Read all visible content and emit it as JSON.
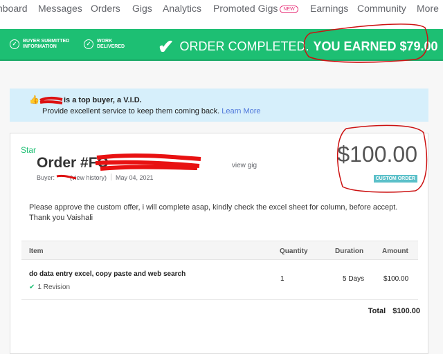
{
  "nav": {
    "items": [
      "hboard",
      "Messages",
      "Orders",
      "Gigs",
      "Analytics",
      "Promoted Gigs",
      "Earnings",
      "Community",
      "More"
    ],
    "new_badge": "NEW"
  },
  "banner": {
    "step1": [
      "BUYER SUBMITTED",
      "INFORMATION"
    ],
    "step2": [
      "WORK",
      "DELIVERED"
    ],
    "status": "ORDER COMPLETED.",
    "earned": "YOU EARNED $79.00"
  },
  "vid": {
    "line1": "is a top buyer, a V.I.D.",
    "line2": "Provide excellent service to keep them coming back.",
    "link": "Learn More"
  },
  "order": {
    "label": "Star",
    "title": "Order #FO",
    "view_gig": "view gig",
    "buyer_label": "Buyer:",
    "view_history": "(view history)",
    "date": "May 04, 2021",
    "price": "$100.00",
    "badge": "CUSTOM ORDER",
    "description": "Please approve the custom offer, i will complete asap, kindly check the excel sheet for column, before accept. Thank you Vaishali"
  },
  "table": {
    "headers": [
      "Item",
      "Quantity",
      "Duration",
      "Amount"
    ],
    "rows": [
      {
        "item": "do data entry excel, copy paste and web search",
        "revision": "1 Revision",
        "quantity": "1",
        "duration": "5 Days",
        "amount": "$100.00"
      }
    ],
    "total_label": "Total",
    "total": "$100.00"
  },
  "colors": {
    "green": "#1dbf73",
    "annotation": "#cc1111"
  }
}
